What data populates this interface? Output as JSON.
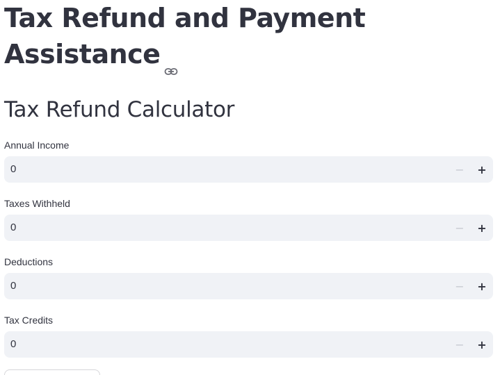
{
  "header": {
    "title": "Tax Refund and Payment Assistance",
    "subheader": "Tax Refund Calculator",
    "anchor_icon": "link-icon"
  },
  "form": {
    "fields": [
      {
        "label": "Annual Income",
        "value": "0",
        "minus": "−",
        "plus": "+"
      },
      {
        "label": "Taxes Withheld",
        "value": "0",
        "minus": "−",
        "plus": "+"
      },
      {
        "label": "Deductions",
        "value": "0",
        "minus": "−",
        "plus": "+"
      },
      {
        "label": "Tax Credits",
        "value": "0",
        "minus": "−",
        "plus": "+"
      }
    ]
  },
  "colors": {
    "text": "#31333f",
    "input_bg": "#f0f2f6",
    "disabled": "#c7c9d0"
  }
}
